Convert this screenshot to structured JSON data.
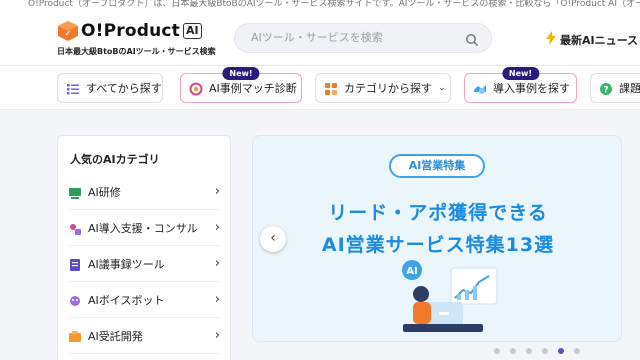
{
  "topbar": {
    "notice": "O!Product（オープロダクト）は、日本最大級BtoBのAIツール・サービス検索サイトです。AIツール・サービスの検索・比較なら「O!Product AI（オープロダクトAI）」"
  },
  "header": {
    "logo_name": "O!Product",
    "logo_badge": "AI",
    "logo_subtitle": "日本最大級BtoBのAIツール・サービス検索",
    "search_placeholder": "AIツール・サービスを検索",
    "news_label": "最新AIニュース"
  },
  "nav": {
    "items": [
      {
        "label": "すべてから探す",
        "icon": "list-icon",
        "new": false
      },
      {
        "label": "AI事例マッチ診断",
        "icon": "diagnosis-icon",
        "new": true,
        "new_label": "New!"
      },
      {
        "label": "カテゴリから探す",
        "icon": "category-icon",
        "new": false
      },
      {
        "label": "導入事例を探す",
        "icon": "case-icon",
        "new": true,
        "new_label": "New!"
      },
      {
        "label": "課題",
        "icon": "question-icon",
        "new": false
      }
    ]
  },
  "sidebar": {
    "title": "人気のAIカテゴリ",
    "items": [
      {
        "label": "AI研修",
        "icon": "training-icon"
      },
      {
        "label": "AI導入支援・コンサル",
        "icon": "consulting-icon"
      },
      {
        "label": "AI議事録ツール",
        "icon": "minutes-icon"
      },
      {
        "label": "AIボイスボット",
        "icon": "voicebot-icon"
      },
      {
        "label": "AI受託開発",
        "icon": "development-icon"
      }
    ]
  },
  "banner": {
    "pill": "AI営業特集",
    "line1": "リード・アポ獲得できる",
    "line2": "AI営業サービス特集13選",
    "badge": "AI",
    "slides_total": 6,
    "slide_active": 5
  },
  "colors": {
    "accent": "#1c8be0",
    "new_tag": "#2a1a7a",
    "logo_orange": "#f07a2a"
  }
}
